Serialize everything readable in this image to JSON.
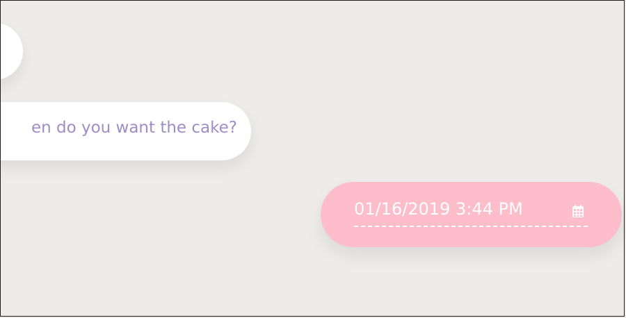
{
  "chat": {
    "question_text": "en do you want the cake?",
    "answer_datetime": "01/16/2019 3:44 PM",
    "answer_icon": "calendar-icon"
  },
  "colors": {
    "background": "#edecea",
    "bubble_white": "#ffffff",
    "question_text": "#9c8fc7",
    "answer_bubble": "#fdbdcb",
    "answer_text": "#ffffff"
  }
}
